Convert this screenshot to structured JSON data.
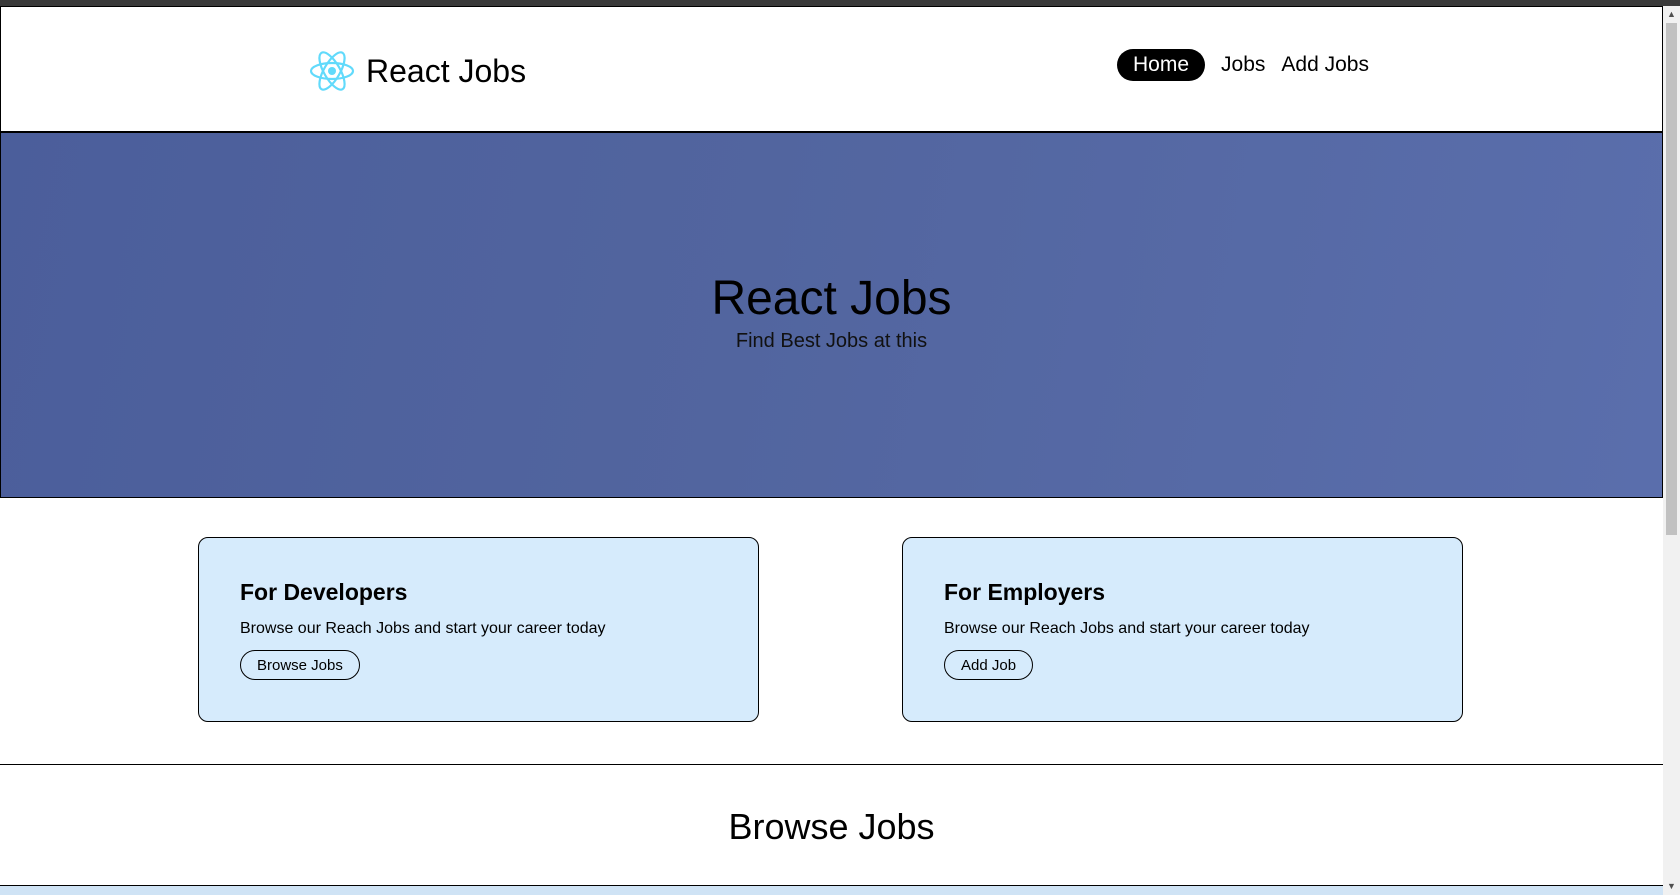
{
  "header": {
    "brand": "React Jobs",
    "logo_icon": "react-atom-icon",
    "nav": [
      {
        "label": "Home",
        "active": true
      },
      {
        "label": "Jobs",
        "active": false
      },
      {
        "label": "Add Jobs",
        "active": false
      }
    ]
  },
  "hero": {
    "title": "React Jobs",
    "subtitle": "Find Best Jobs at this"
  },
  "cards": [
    {
      "title": "For Developers",
      "description": "Browse our Reach Jobs and start your career today",
      "button": "Browse Jobs"
    },
    {
      "title": "For Employers",
      "description": "Browse our Reach Jobs and start your career today",
      "button": "Add Job"
    }
  ],
  "section": {
    "title": "Browse Jobs"
  },
  "colors": {
    "hero_bg": "#52659f",
    "card_bg": "#d6ebfc",
    "logo": "#61dafb",
    "active_nav_bg": "#000000"
  }
}
